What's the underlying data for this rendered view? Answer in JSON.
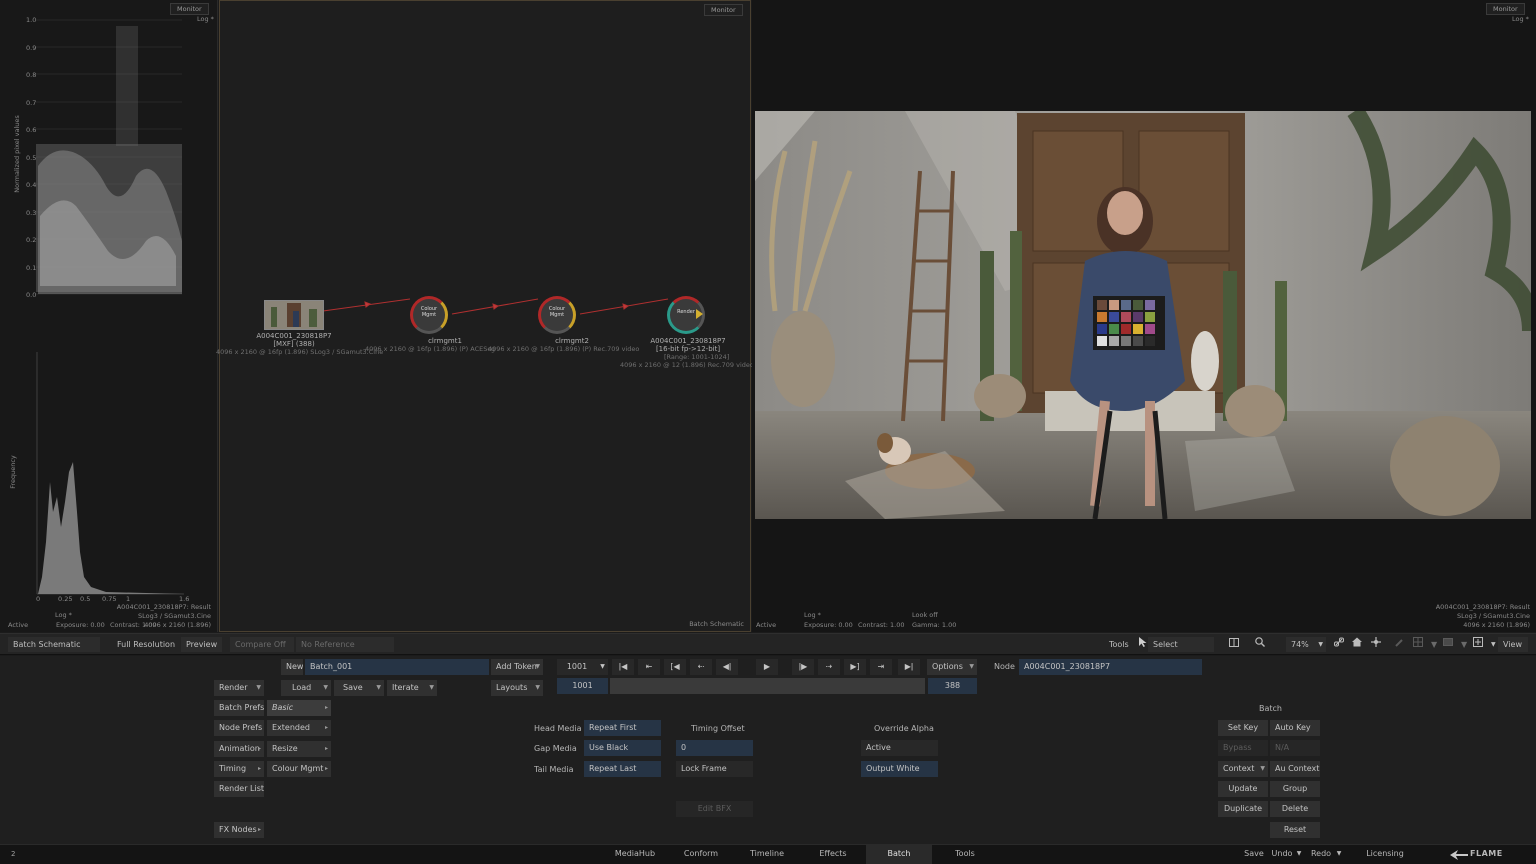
{
  "scopes": {
    "monitor_label": "Monitor",
    "log_label": "Log *",
    "waveform_ylabel": "Normalized pixel values",
    "waveform_ticks": [
      "1.0",
      "0.9",
      "0.8",
      "0.7",
      "0.6",
      "0.5",
      "0.4",
      "0.3",
      "0.2",
      "0.1",
      "0.0"
    ],
    "histogram_ylabel": "Frequency",
    "histogram_ticks": [
      "0",
      "0.25",
      "0.5",
      "0.75",
      "1",
      "1.6"
    ],
    "hist_log": "Log *",
    "result_line1": "A004C001_230818P7: Result",
    "result_line2": "SLog3 / SGamut3.Cine",
    "result_line3": "4096 x 2160 (1.896)",
    "status_active": "Active",
    "exposure": "Exposure: 0.00",
    "contrast": "Contrast: 1.00"
  },
  "schematic": {
    "monitor_label": "Monitor",
    "panel_label": "Batch Schematic",
    "nodes": [
      {
        "name": "A004C001_230818P7",
        "sub": "[MXF] (388)",
        "info": "4096 x 2160 @ 16fp (1.896)  SLog3 / SGamut3.Cine"
      },
      {
        "name": "clrmgmt1",
        "badge": "Colour\nMgmt",
        "info": "4096 x 2160 @ 16fp (1.896) (P) ACEScg"
      },
      {
        "name": "clrmgmt2",
        "badge": "Colour\nMgmt",
        "info": "4096 x 2160 @ 16fp (1.896) (P) Rec.709 video"
      },
      {
        "name": "A004C001_230818P7",
        "sub": "[16-bit fp->12-bit]",
        "sub2": "[Range: 1001-1024]",
        "badge": "Render",
        "info": "4096 x 2160 @ 12 (1.896)  Rec.709 video"
      }
    ]
  },
  "viewer": {
    "monitor_label": "Monitor",
    "log_label": "Log *",
    "look": "Look off",
    "active": "Active",
    "exposure": "Exposure: 0.00",
    "contrast": "Contrast: 1.00",
    "gamma": "Gamma: 1.00",
    "result_line1": "A004C001_230818P7: Result",
    "result_line2": "SLog3 / SGamut3.Cine",
    "result_line3": "4096 x 2160 (1.896)"
  },
  "toolbar": {
    "batch_schematic": "Batch Schematic",
    "full_resolution": "Full Resolution",
    "preview": "Preview",
    "compare_off": "Compare Off",
    "no_reference": "No Reference",
    "tools": "Tools",
    "select": "Select",
    "zoom": "74%",
    "view": "View"
  },
  "batch": {
    "new": "New",
    "batch_name": "Batch_001",
    "add_token": "Add Token",
    "frame_start": "1001",
    "frame_field": "1001",
    "frame_end": "388",
    "options": "Options",
    "node_label": "Node",
    "node_name": "A004C001_230818P7",
    "render": "Render",
    "load": "Load",
    "save": "Save",
    "iterate": "Iterate",
    "layouts": "Layouts",
    "batch_prefs": "Batch Prefs",
    "basic": "Basic",
    "node_prefs": "Node Prefs",
    "extended": "Extended",
    "animation": "Animation",
    "resize": "Resize",
    "timing": "Timing",
    "colour_mgmt": "Colour Mgmt",
    "render_list": "Render List",
    "fx_nodes": "FX Nodes",
    "head_media": "Head Media",
    "head_media_val": "Repeat First",
    "gap_media": "Gap Media",
    "gap_media_val": "Use Black",
    "tail_media": "Tail Media",
    "tail_media_val": "Repeat Last",
    "timing_offset": "Timing Offset",
    "timing_offset_val": "0",
    "lock_frame": "Lock Frame",
    "edit_bfx": "Edit BFX",
    "override_alpha": "Override Alpha",
    "active": "Active",
    "output_white": "Output White",
    "batch_title": "Batch",
    "set_key": "Set Key",
    "auto_key": "Auto Key",
    "bypass": "Bypass",
    "na": "N/A",
    "context": "Context",
    "au_context": "Au Context",
    "update": "Update",
    "group": "Group",
    "duplicate": "Duplicate",
    "delete": "Delete",
    "reset": "Reset"
  },
  "status": {
    "left_glyph": "2",
    "tabs": [
      "MediaHub",
      "Conform",
      "Timeline",
      "Effects",
      "Batch",
      "Tools"
    ],
    "save": "Save",
    "undo": "Undo",
    "redo": "Redo",
    "licensing": "Licensing",
    "brand": "FLAME"
  }
}
